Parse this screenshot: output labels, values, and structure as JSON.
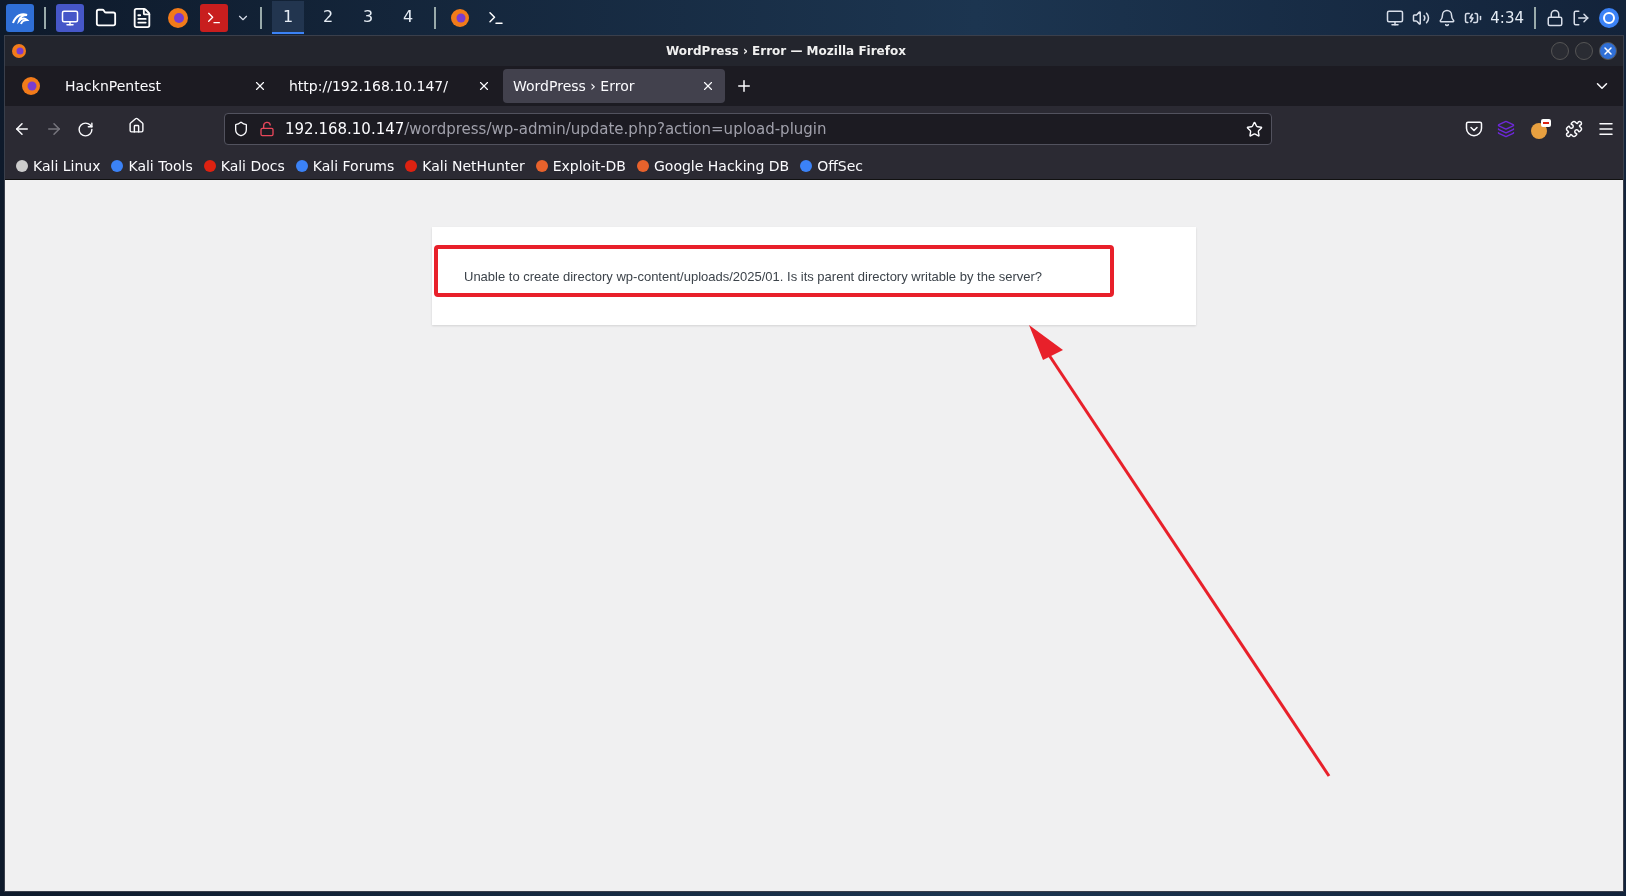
{
  "taskbar": {
    "workspaces": [
      {
        "label": "1",
        "selected": true
      },
      {
        "label": "2",
        "selected": false
      },
      {
        "label": "3",
        "selected": false
      },
      {
        "label": "4",
        "selected": false
      }
    ],
    "clock": "4:34"
  },
  "window": {
    "title": "WordPress › Error — Mozilla Firefox"
  },
  "tabs": [
    {
      "label": "HacknPentest",
      "selected": false
    },
    {
      "label": "http://192.168.10.147/",
      "selected": false
    },
    {
      "label": "WordPress › Error",
      "selected": true
    }
  ],
  "address_bar": {
    "host": "192.168.10.147",
    "path": "/wordpress/wp-admin/update.php?action=upload-plugin"
  },
  "bookmarks": [
    "Kali Linux",
    "Kali Tools",
    "Kali Docs",
    "Kali Forums",
    "Kali NetHunter",
    "Exploit-DB",
    "Google Hacking DB",
    "OffSec"
  ],
  "error": {
    "message": "Unable to create directory wp-content/uploads/2025/01. Is its parent directory writable by the server?"
  }
}
